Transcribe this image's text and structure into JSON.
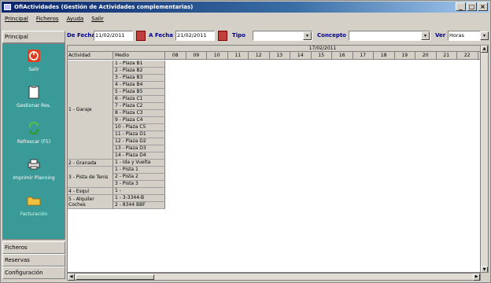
{
  "window": {
    "title": "OfiActividades (Gestión de Actividades complementarias)",
    "controls": [
      "_",
      "□",
      "×"
    ]
  },
  "menu": [
    "Principal",
    "Ficheros",
    "Ayuda",
    "Salir"
  ],
  "left_panel": {
    "header": "Principal",
    "buttons": [
      {
        "label": "Salir",
        "icon": "power-icon"
      },
      {
        "label": "Gestionar Res.",
        "icon": "clipboard-icon"
      },
      {
        "label": "Refrescar (F5)",
        "icon": "refresh-icon"
      },
      {
        "label": "Imprimir Planning",
        "icon": "printer-icon"
      },
      {
        "label": "Facturación",
        "icon": "folder-icon"
      }
    ],
    "tabs": [
      "Ficheros",
      "Reservas",
      "Configuración"
    ]
  },
  "toolbar": {
    "de_fecha_label": "De Fecha",
    "de_fecha_value": "11/02/2011",
    "a_fecha_label": "A Fecha",
    "a_fecha_value": "21/02/2011",
    "tipo_label": "Tipo",
    "tipo_value": "",
    "concepto_label": "Concepto",
    "concepto_value": "",
    "ver_label": "Ver",
    "ver_value": "Horas"
  },
  "grid": {
    "date_header": "17/02/2011",
    "col_actividad": "Actividad",
    "col_medio": "Medio",
    "hours": [
      "08",
      "09",
      "10",
      "11",
      "12",
      "13",
      "14",
      "15",
      "16",
      "17",
      "18",
      "19",
      "20",
      "21",
      "22"
    ],
    "groups": [
      {
        "name": "1 - Garaje",
        "rows": [
          "1 - Plaza B1",
          "2 - Plaza B2",
          "3 - Plaza B3",
          "4 - Plaza B4",
          "5 - Plaza B5",
          "6 - Plaza C1",
          "7 - Plaza C2",
          "8 - Plaza C3",
          "9 - Plaza C4",
          "10 - Plaza C5",
          "11 - Plaza D1",
          "12 - Plaza D2",
          "13 - Plaza D3",
          "14 - Plaza D4"
        ]
      },
      {
        "name": "2 - Granada",
        "rows": [
          "1 - Ida y Vuelta"
        ]
      },
      {
        "name": "3 - Pista de Tenis",
        "rows": [
          "1 - Pista 1",
          "2 - Pista 2",
          "3 - Pista 3"
        ]
      },
      {
        "name": "4 - Esquí",
        "rows": [
          "1 -"
        ]
      },
      {
        "name": "5 - Alquiler Coches",
        "rows": [
          "1 - 3-3344-B",
          "2 - 8344 BBF"
        ]
      }
    ]
  }
}
